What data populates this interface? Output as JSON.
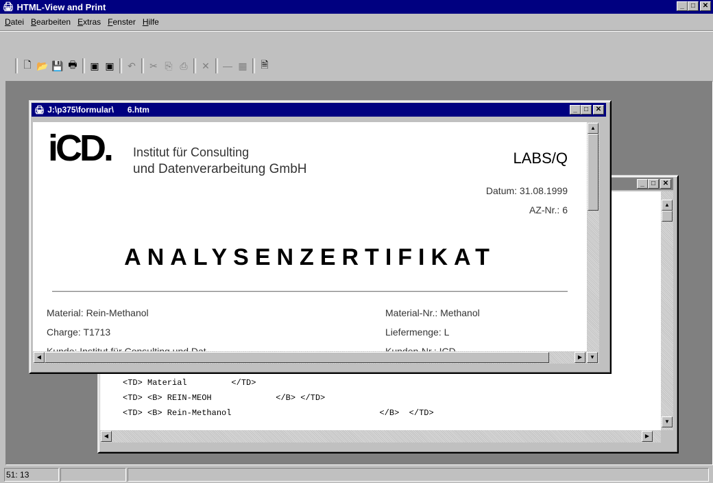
{
  "app": {
    "title": "HTML-View and Print",
    "icon": "printer-app-icon"
  },
  "menu": [
    {
      "accel": "D",
      "rest": "atei"
    },
    {
      "accel": "B",
      "rest": "earbeiten"
    },
    {
      "accel": "E",
      "rest": "xtras"
    },
    {
      "accel": "F",
      "rest": "enster"
    },
    {
      "accel": "H",
      "rest": "ilfe"
    }
  ],
  "toolbar": {
    "new": "🗋",
    "open": "📂",
    "save": "💾",
    "print": "🖶",
    "view1": "▣",
    "view2": "▣",
    "undo": "↶",
    "cut": "✂",
    "copy": "⎘",
    "paste": "⎙",
    "delete": "✕",
    "line": "—",
    "table": "▦",
    "page": "🗎"
  },
  "doc_window": {
    "title": "J:\\p375\\formular\\      6.htm",
    "company_line1": "Institut für Consulting",
    "company_line2": "und Datenverarbeitung GmbH",
    "logo_text": "iCD.",
    "product": "LABS/Q",
    "datum": "Datum: 31.08.1999",
    "aznr": "AZ-Nr.: 6",
    "heading": "ANALYSENZERTIFIKAT",
    "material": "Material: Rein-Methanol",
    "material_nr": "Material-Nr.: Methanol",
    "charge": "Charge: T1713",
    "liefermenge": "Liefermenge: L",
    "cut_left": "Kunde: Institut für Consulting und Dat",
    "cut_right": "Kunden-Nr.: ICD"
  },
  "source_window": {
    "lines": [
      "<TD> Material         </TD>",
      "<TD> <B> REIN-MEOH             </B> </TD>",
      "<TD> <B> Rein-Methanol                              </B>  </TD>"
    ]
  },
  "status": {
    "position": "51: 13",
    "pane2": "",
    "pane3": ""
  },
  "buttons": {
    "min": "_",
    "max": "□",
    "close": "✕"
  }
}
